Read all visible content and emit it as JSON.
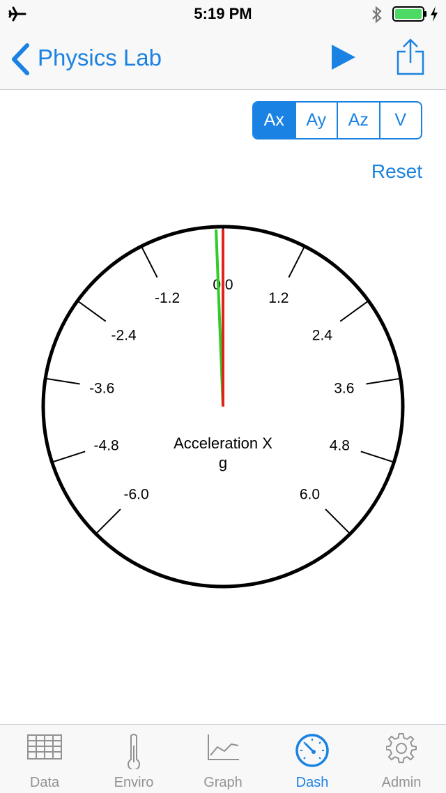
{
  "status_bar": {
    "time": "5:19 PM",
    "airplane_icon": "airplane-icon",
    "bluetooth_icon": "bluetooth-icon",
    "battery_icon": "battery-icon",
    "charging_icon": "charging-bolt-icon"
  },
  "nav": {
    "back_label": "Physics Lab",
    "play_icon": "play-icon",
    "share_icon": "share-icon"
  },
  "segments": [
    {
      "label": "Ax",
      "active": true
    },
    {
      "label": "Ay",
      "active": false
    },
    {
      "label": "Az",
      "active": false
    },
    {
      "label": "V",
      "active": false
    }
  ],
  "reset_label": "Reset",
  "gauge": {
    "title": "Acceleration X",
    "unit": "g",
    "tick_labels": [
      "-6.0",
      "-4.8",
      "-3.6",
      "-2.4",
      "-1.2",
      "0.0",
      "1.2",
      "2.4",
      "3.6",
      "4.8",
      "6.0"
    ],
    "value": 0.0,
    "secondary_value": -0.1,
    "value_needle_color": "#e0241c",
    "secondary_needle_color": "#2fcc2a"
  },
  "tabs": [
    {
      "label": "Data",
      "icon": "table-icon",
      "active": false
    },
    {
      "label": "Enviro",
      "icon": "thermometer-icon",
      "active": false
    },
    {
      "label": "Graph",
      "icon": "line-graph-icon",
      "active": false
    },
    {
      "label": "Dash",
      "icon": "dashboard-gauge-icon",
      "active": true
    },
    {
      "label": "Admin",
      "icon": "gear-icon",
      "active": false
    }
  ],
  "colors": {
    "accent": "#1a82e2",
    "bar_background": "#f8f8f8",
    "inactive_tab": "#929292"
  }
}
